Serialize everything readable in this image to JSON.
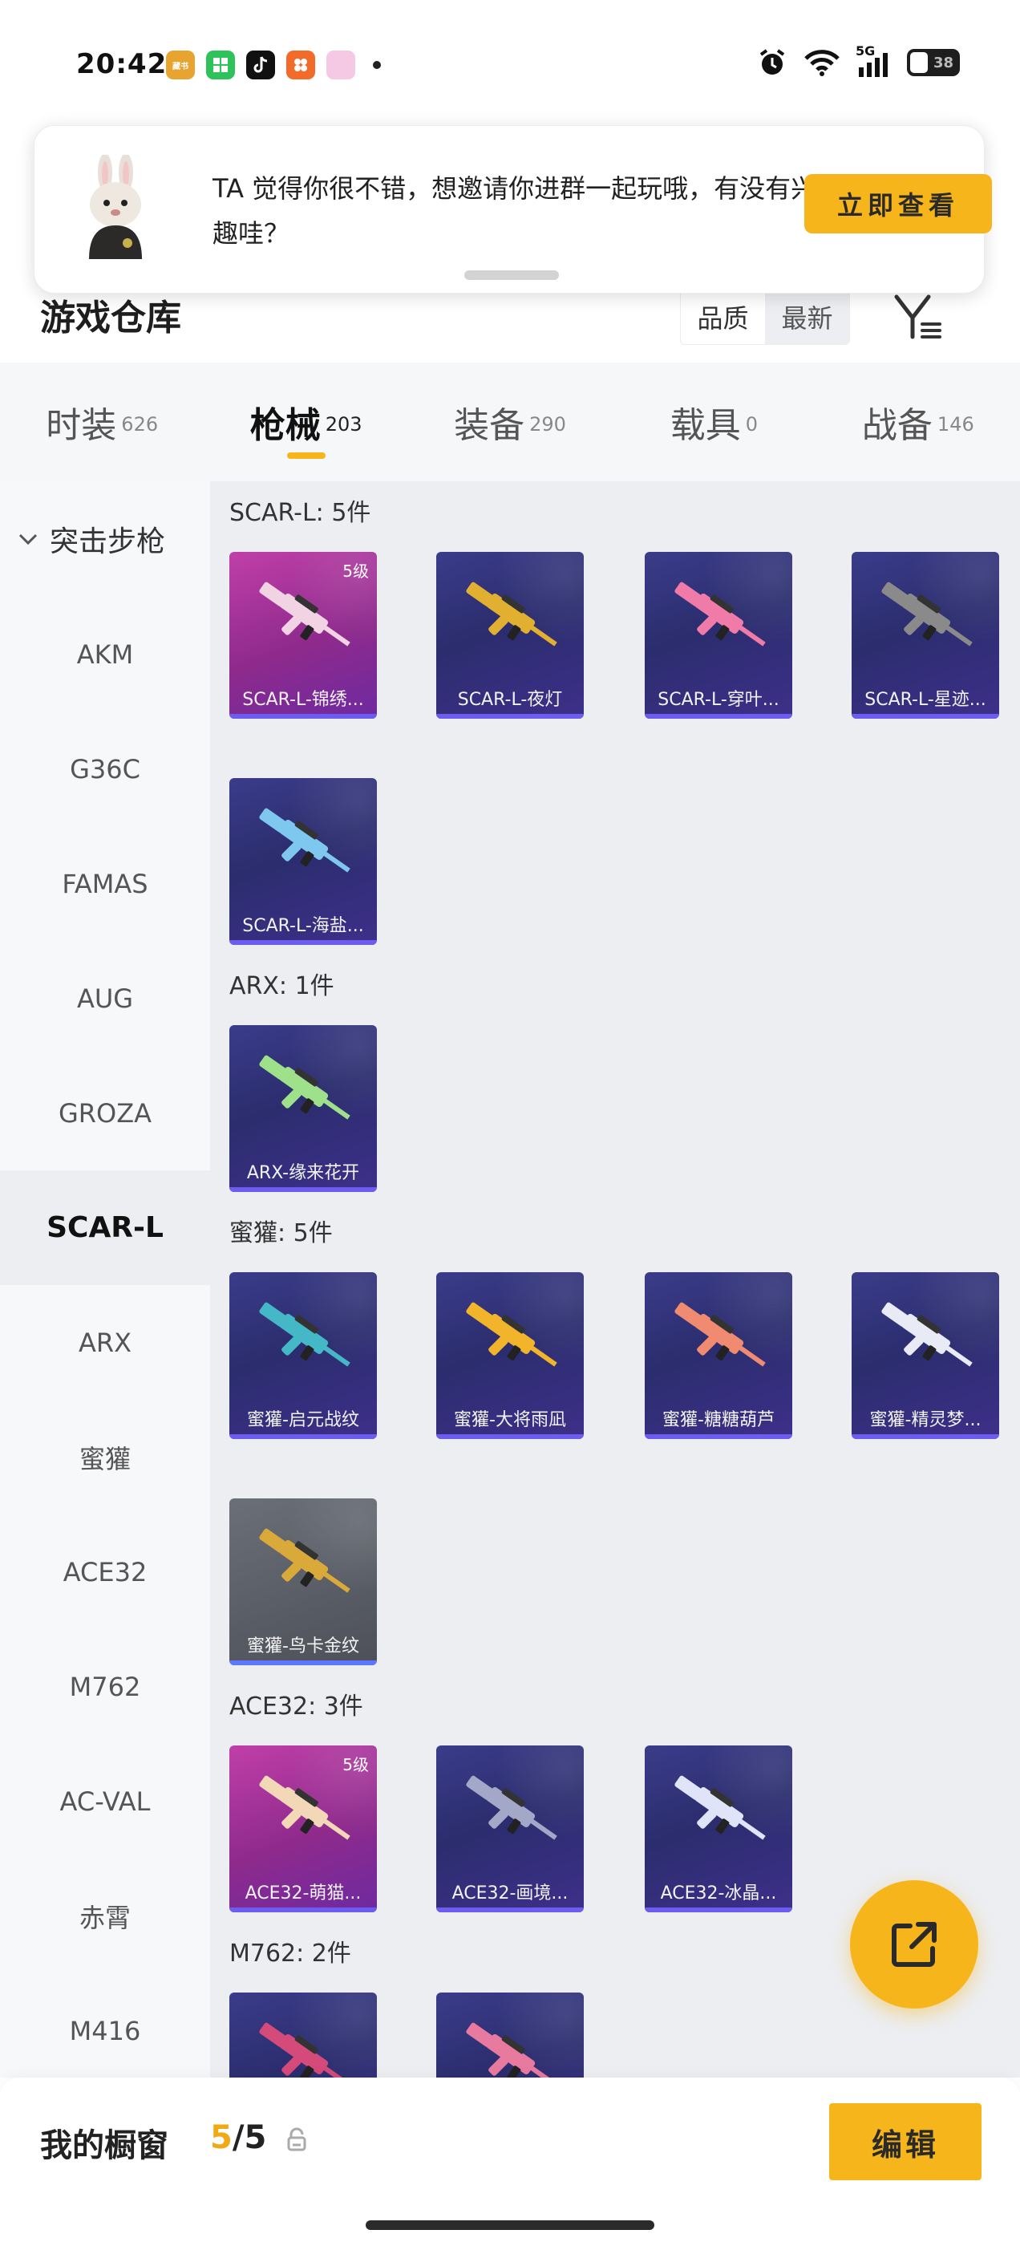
{
  "status_bar": {
    "time": "20:42",
    "notification_apps": [
      {
        "icon": "app-icon-1",
        "color": "#e8a431",
        "label": "藏书"
      },
      {
        "icon": "app-icon-2",
        "color": "#2ec25a",
        "label": ""
      },
      {
        "icon": "tiktok-icon",
        "color": "#111111",
        "label": ""
      },
      {
        "icon": "app-icon-4",
        "color": "#f26b2a",
        "label": ""
      },
      {
        "icon": "app-icon-5",
        "color": "#f5c8e3",
        "label": ""
      }
    ],
    "network": "5G",
    "battery": "38"
  },
  "popup": {
    "message": "TA 觉得你很不错，想邀请你进群一起玩哦，有没有兴趣哇？",
    "button_label": "立即查看"
  },
  "header": {
    "title": "游戏仓库",
    "sort_options": [
      "品质",
      "最新"
    ],
    "active_sort": "最新"
  },
  "tabs": [
    {
      "label": "时装",
      "count": "626"
    },
    {
      "label": "枪械",
      "count": "203",
      "active": true
    },
    {
      "label": "装备",
      "count": "290"
    },
    {
      "label": "载具",
      "count": "0"
    },
    {
      "label": "战备",
      "count": "146"
    }
  ],
  "sidebar": {
    "group_label": "突击步枪",
    "items": [
      "AKM",
      "G36C",
      "FAMAS",
      "AUG",
      "GROZA",
      "SCAR-L",
      "ARX",
      "蜜獾",
      "ACE32",
      "M762",
      "AC-VAL",
      "赤霄",
      "M416"
    ],
    "active_item": "SCAR-L"
  },
  "sections": [
    {
      "title": "SCAR-L: 5件",
      "items": [
        {
          "name": "SCAR-L-锦绣...",
          "level": "5级",
          "style": "pink",
          "gun": "#f1d3e4"
        },
        {
          "name": "SCAR-L-夜灯",
          "level": "",
          "style": "purple",
          "gun": "#e2b030"
        },
        {
          "name": "SCAR-L-穿叶...",
          "level": "",
          "style": "purple",
          "gun": "#f07aa8"
        },
        {
          "name": "SCAR-L-星迹...",
          "level": "",
          "style": "purple",
          "gun": "#8a8a8a"
        },
        {
          "name": "SCAR-L-海盐...",
          "level": "",
          "style": "purple",
          "gun": "#7ec8f0"
        }
      ]
    },
    {
      "title": "ARX: 1件",
      "items": [
        {
          "name": "ARX-缘来花开",
          "level": "",
          "style": "purple",
          "gun": "#9fe08a"
        }
      ]
    },
    {
      "title": "蜜獾: 5件",
      "items": [
        {
          "name": "蜜獾-启元战纹",
          "level": "",
          "style": "purple",
          "gun": "#45b8c8"
        },
        {
          "name": "蜜獾-大将雨凪",
          "level": "",
          "style": "purple",
          "gun": "#f2b42a"
        },
        {
          "name": "蜜獾-糖糖葫芦",
          "level": "",
          "style": "purple",
          "gun": "#f08a70"
        },
        {
          "name": "蜜獾-精灵梦...",
          "level": "",
          "style": "purple",
          "gun": "#e8eaf5"
        },
        {
          "name": "蜜獾-鸟卡金纹",
          "level": "",
          "style": "gray",
          "gun": "#d9a93a"
        }
      ]
    },
    {
      "title": "ACE32: 3件",
      "items": [
        {
          "name": "ACE32-萌猫...",
          "level": "5级",
          "style": "pink",
          "gun": "#f3d8b8"
        },
        {
          "name": "ACE32-画境...",
          "level": "",
          "style": "purple",
          "gun": "#a3a8c8"
        },
        {
          "name": "ACE32-冰晶...",
          "level": "",
          "style": "purple",
          "gun": "#dfe4f8"
        }
      ]
    },
    {
      "title": "M762: 2件",
      "items": [
        {
          "name": "",
          "level": "",
          "style": "purple",
          "gun": "#d44a7a"
        },
        {
          "name": "",
          "level": "",
          "style": "purple",
          "gun": "#e87aa0"
        }
      ]
    }
  ],
  "bottom": {
    "showcase_label": "我的橱窗",
    "count_current": "5",
    "count_total": "/5",
    "edit_label": "编辑"
  },
  "colors": {
    "accent": "#f7b51c",
    "card_purple": "#2f3172",
    "card_pink": "#a8389a"
  }
}
